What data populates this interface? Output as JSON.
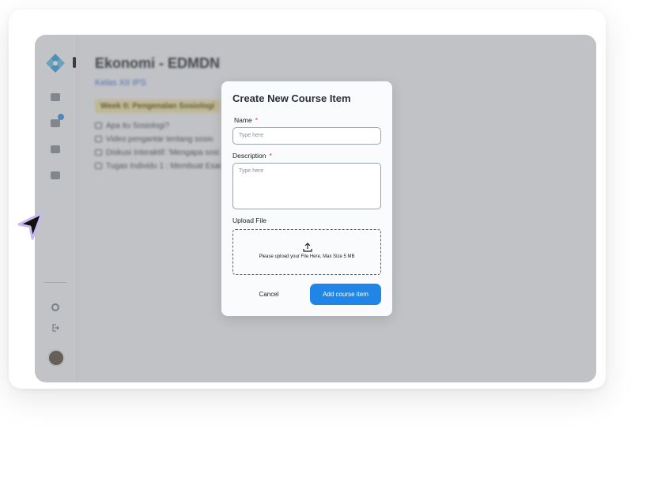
{
  "course": {
    "title": "Ekonomi - EDMDN",
    "class_name": "Kelas XII IPS",
    "week_label": "Week 0: Pengenalan Sosiologi",
    "items": [
      "Apa itu Sosiologi?",
      "Video pengantar tentang sosio",
      "Diskusi Interaktif: 'Mengapa sosi",
      "Tugas Individu 1 : Membuat Esai"
    ]
  },
  "modal": {
    "title": "Create New Course Item",
    "name_label": "Name",
    "required_mark": "*",
    "name_placeholder": "Type here",
    "description_label": "Description",
    "description_placeholder": "Type here",
    "upload_label": "Upload File",
    "upload_hint": "Please upload your File Here, Max Size 5 MB",
    "cancel_label": "Cancel",
    "add_label": "Add course item"
  },
  "colors": {
    "primary": "#1f86e8",
    "required": "#e03131",
    "overlay": "#787a7e"
  },
  "icons": [
    "logo-icon",
    "dashboard-icon",
    "courses-icon",
    "calendar-icon",
    "inbox-icon",
    "settings-icon",
    "logout-icon",
    "upload-icon",
    "cursor-icon"
  ]
}
